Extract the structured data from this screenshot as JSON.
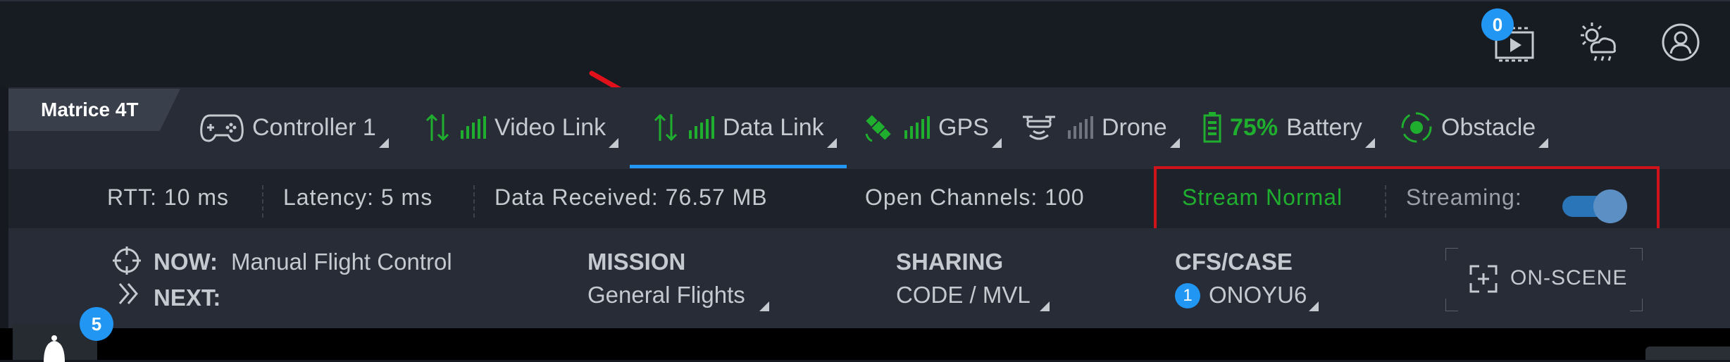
{
  "header": {
    "media_badge": "0",
    "icons": [
      "video-library-icon",
      "weather-icon",
      "user-account-icon"
    ]
  },
  "aircraft": {
    "label": "Matrice 4T"
  },
  "tabs": [
    {
      "label": "Controller 1",
      "icon": "controller-icon"
    },
    {
      "label": "Video Link",
      "icon": "signal-transfer-icon"
    },
    {
      "label": "Data Link",
      "icon": "signal-transfer-icon",
      "active": true
    },
    {
      "label": "GPS",
      "icon": "satellite-icon"
    },
    {
      "label": "Drone",
      "icon": "drone-icon"
    },
    {
      "label": "Battery",
      "value": "75%",
      "icon": "battery-icon"
    },
    {
      "label": "Obstacle",
      "icon": "obstacle-sensor-icon"
    }
  ],
  "stats": {
    "rtt": "RTT: 10 ms",
    "latency": "Latency: 5 ms",
    "data_received": "Data Received: 76.57 MB",
    "open_channels": "Open Channels: 100",
    "stream_status": "Stream Normal",
    "streaming_label": "Streaming:",
    "streaming_on": true
  },
  "info": {
    "now_label": "NOW:",
    "now_value": "Manual Flight Control",
    "next_label": "NEXT:",
    "mission_label": "MISSION",
    "mission_value": "General Flights",
    "sharing_label": "SHARING",
    "sharing_value": "CODE / MVL",
    "cfs_label": "CFS/CASE",
    "cfs_count": "1",
    "cfs_value": "ONOYU6",
    "onscene_label": "ON-SCENE"
  },
  "notifications": {
    "badge": "5"
  },
  "colors": {
    "accent_blue": "#2196f3",
    "status_green": "#1fae2e",
    "annotation_red": "#d0121b"
  }
}
